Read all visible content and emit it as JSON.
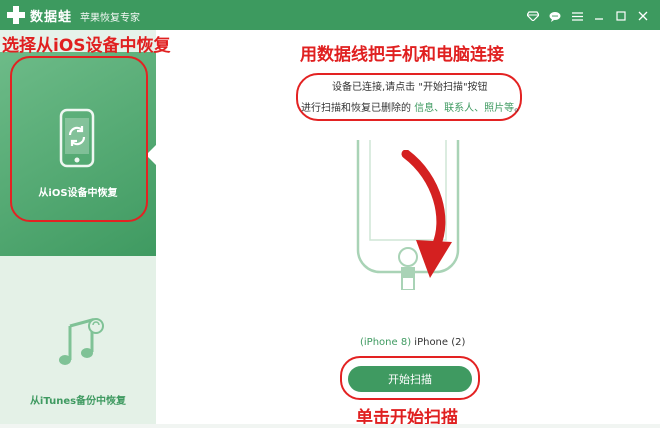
{
  "titlebar": {
    "brand": "数据蛙",
    "subtitle": "苹果恢复专家",
    "controls": [
      "diamond-icon",
      "chat-icon",
      "menu-icon",
      "minimize-icon",
      "maximize-icon",
      "close-icon"
    ]
  },
  "sidebar": {
    "items": [
      {
        "label": "从iOS设备中恢复",
        "icon": "phone-refresh-icon",
        "active": true
      },
      {
        "label": "从iTunes备份中恢复",
        "icon": "music-note-icon",
        "active": false
      }
    ]
  },
  "annotations": {
    "left": "选择从iOS设备中恢复",
    "top": "用数据线把手机和电脑连接",
    "bottom": "单击开始扫描"
  },
  "main": {
    "instruction_line1": "设备已连接,请点击 \"开始扫描\"按钮",
    "instruction_line2_prefix": "进行扫描和恢复已删除的",
    "instruction_highlights": "信息、联系人、照片等",
    "instruction_line2_suffix": "。",
    "device_model": "(iPhone 8)",
    "device_name": "iPhone (2)",
    "start_button": "开始扫描"
  },
  "colors": {
    "brand_green": "#3d9a5f",
    "annotation_red": "#e32222"
  }
}
